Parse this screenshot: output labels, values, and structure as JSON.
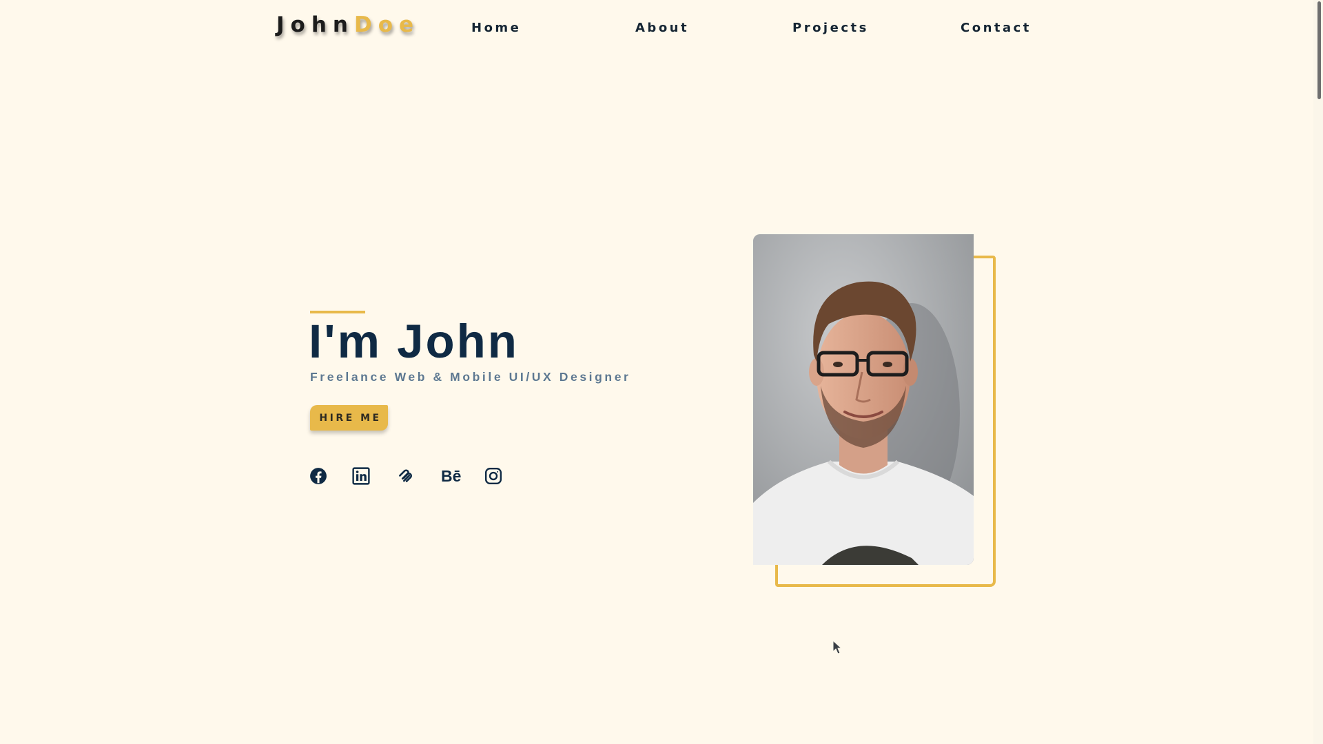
{
  "nav": {
    "logo_first": "John",
    "logo_last": "Doe",
    "links": [
      "Home",
      "About",
      "Projects",
      "Contact"
    ]
  },
  "hero": {
    "title": "I'm John",
    "subtitle": "Freelance Web & Mobile UI/UX Designer",
    "cta_label": "HIRE ME"
  },
  "social": {
    "icons": [
      "facebook-icon",
      "linkedin-icon",
      "squarespace-icon",
      "behance-icon",
      "instagram-icon"
    ],
    "behance_glyph": "Bē"
  },
  "portrait": {
    "subject": "portrait-photo"
  },
  "colors": {
    "background": "#fff9ec",
    "accent": "#e8b94a",
    "navy": "#0f2a44",
    "subtitle": "#5d7891"
  }
}
